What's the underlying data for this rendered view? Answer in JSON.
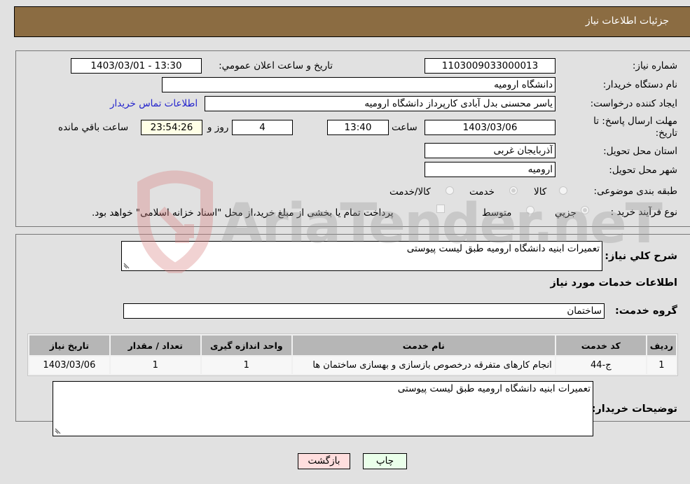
{
  "header": {
    "title": "جزئیات اطلاعات نیاز"
  },
  "form": {
    "need_number": {
      "label": "شماره نیاز:",
      "value": "1103009033000013"
    },
    "announce_datetime": {
      "label": "تاریخ و ساعت اعلان عمومي:",
      "value": "1403/03/01 - 13:30"
    },
    "buyer_org": {
      "label": "نام دستگاه خريدار:",
      "value": "دانشگاه ارومیه"
    },
    "requester": {
      "label": "ایجاد کننده درخواست:",
      "value": "یاسر محسنی بدل آبادی کارپرداز دانشگاه ارومیه",
      "contact_link": "اطلاعات تماس خریدار"
    },
    "deadline": {
      "label": "مهلت ارسال پاسخ: تا تاریخ:",
      "date": "1403/03/06",
      "time_label": "ساعت",
      "time": "13:40",
      "days": "4",
      "days_label": "روز و",
      "remaining": "23:54:26",
      "remaining_label": "ساعت باقي مانده"
    },
    "province": {
      "label": "استان محل تحویل:",
      "value": "آذربایجان غربی"
    },
    "city": {
      "label": "شهر محل تحویل:",
      "value": "ارومیه"
    },
    "category": {
      "label": "طبقه بندی موضوعی:",
      "options": [
        {
          "label": "کالا",
          "checked": false
        },
        {
          "label": "خدمت",
          "checked": true
        },
        {
          "label": "کالا/خدمت",
          "checked": false
        }
      ]
    },
    "purchase_type": {
      "label": "نوع فرآیند خرید :",
      "options": [
        {
          "label": "جزيي",
          "checked": true
        },
        {
          "label": "متوسط",
          "checked": false
        }
      ],
      "treasury_checkbox_label": "پرداخت تمام یا بخشی از مبلغ خرید،از محل \"اسناد خزانه اسلامی\" خواهد بود.",
      "treasury_checked": false
    }
  },
  "details": {
    "summary_label": "شرح کلي نياز:",
    "summary_value": "تعمیرات ابنیه دانشگاه ارومیه طبق لیست پیوستی",
    "services_heading": "اطلاعات خدمات مورد نیاز",
    "service_group_label": "گروه خدمت:",
    "service_group_value": "ساختمان",
    "table": {
      "headers": [
        "ردیف",
        "کد خدمت",
        "نام خدمت",
        "واحد اندازه گیری",
        "تعداد / مقدار",
        "تاریخ نیاز"
      ],
      "rows": [
        [
          "1",
          "ج-44",
          "انجام کارهای متفرقه درخصوص بازسازی و بهسازی ساختمان ها",
          "1",
          "1",
          "1403/03/06"
        ]
      ]
    },
    "buyer_notes_label": "توضیحات خریدار:",
    "buyer_notes_value": "تعمیرات ابنیه دانشگاه ارومیه طبق لیست پیوستی"
  },
  "buttons": {
    "print": "چاپ",
    "back": "بازگشت"
  },
  "watermark": {
    "text": "AriaTender.neT"
  },
  "colors": {
    "header_bg": "#8b6c42",
    "print_bg": "#eaffea",
    "back_bg": "#ffdede",
    "link": "#2222cc"
  }
}
